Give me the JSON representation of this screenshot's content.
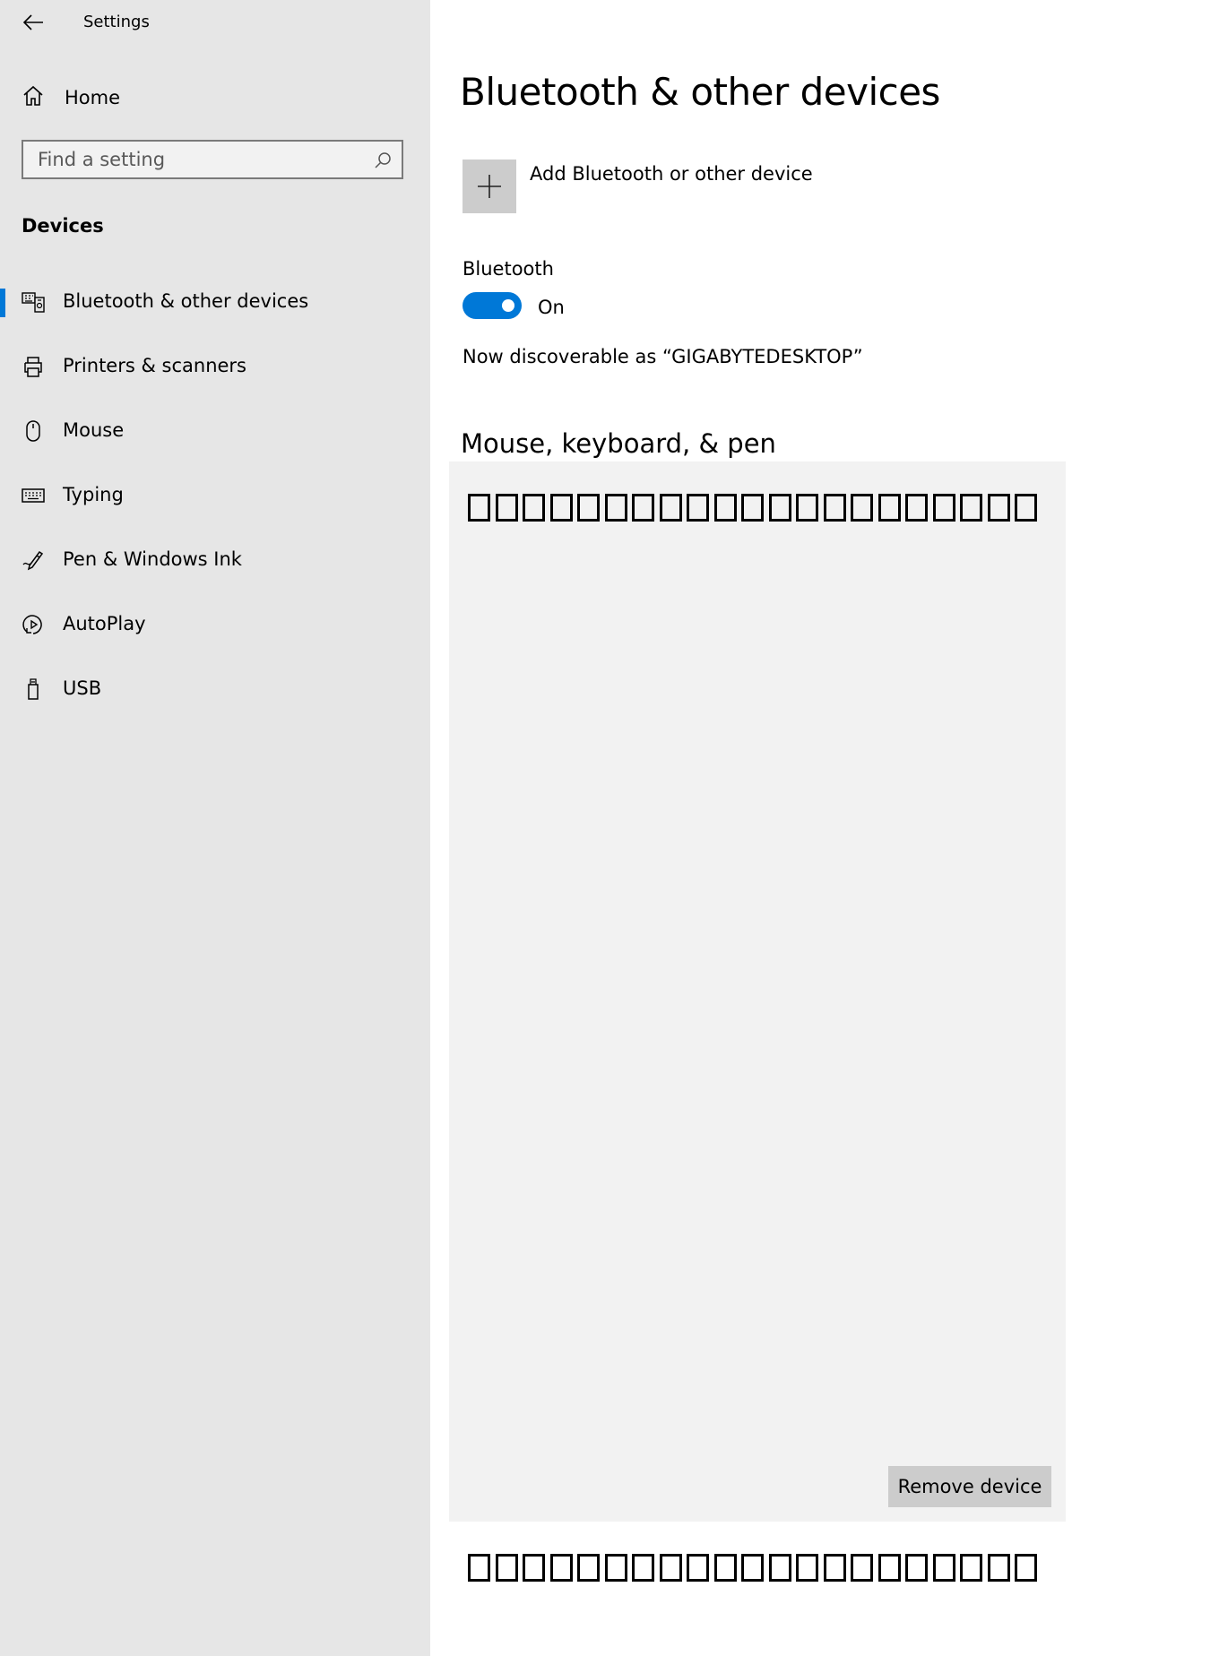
{
  "window": {
    "title": "Settings"
  },
  "sidebar": {
    "home_label": "Home",
    "search_placeholder": "Find a setting",
    "section_heading": "Devices",
    "items": [
      {
        "label": "Bluetooth & other devices",
        "icon": "bluetooth-devices-icon",
        "active": true
      },
      {
        "label": "Printers & scanners",
        "icon": "printer-icon",
        "active": false
      },
      {
        "label": "Mouse",
        "icon": "mouse-icon",
        "active": false
      },
      {
        "label": "Typing",
        "icon": "keyboard-icon",
        "active": false
      },
      {
        "label": "Pen & Windows Ink",
        "icon": "pen-icon",
        "active": false
      },
      {
        "label": "AutoPlay",
        "icon": "autoplay-icon",
        "active": false
      },
      {
        "label": "USB",
        "icon": "usb-icon",
        "active": false
      }
    ]
  },
  "main": {
    "title": "Bluetooth & other devices",
    "add_device_label": "Add Bluetooth or other device",
    "bluetooth_label": "Bluetooth",
    "bluetooth_state": "On",
    "discoverable_text": "Now discoverable as “GIGABYTEDESKTOP”",
    "group_heading": "Mouse, keyboard, & pen",
    "remove_button_label": "Remove device"
  },
  "colors": {
    "accent": "#0078d7",
    "sidebar_bg": "#e6e6e6",
    "panel_bg": "#f2f2f2",
    "button_bg": "#cccccc"
  }
}
